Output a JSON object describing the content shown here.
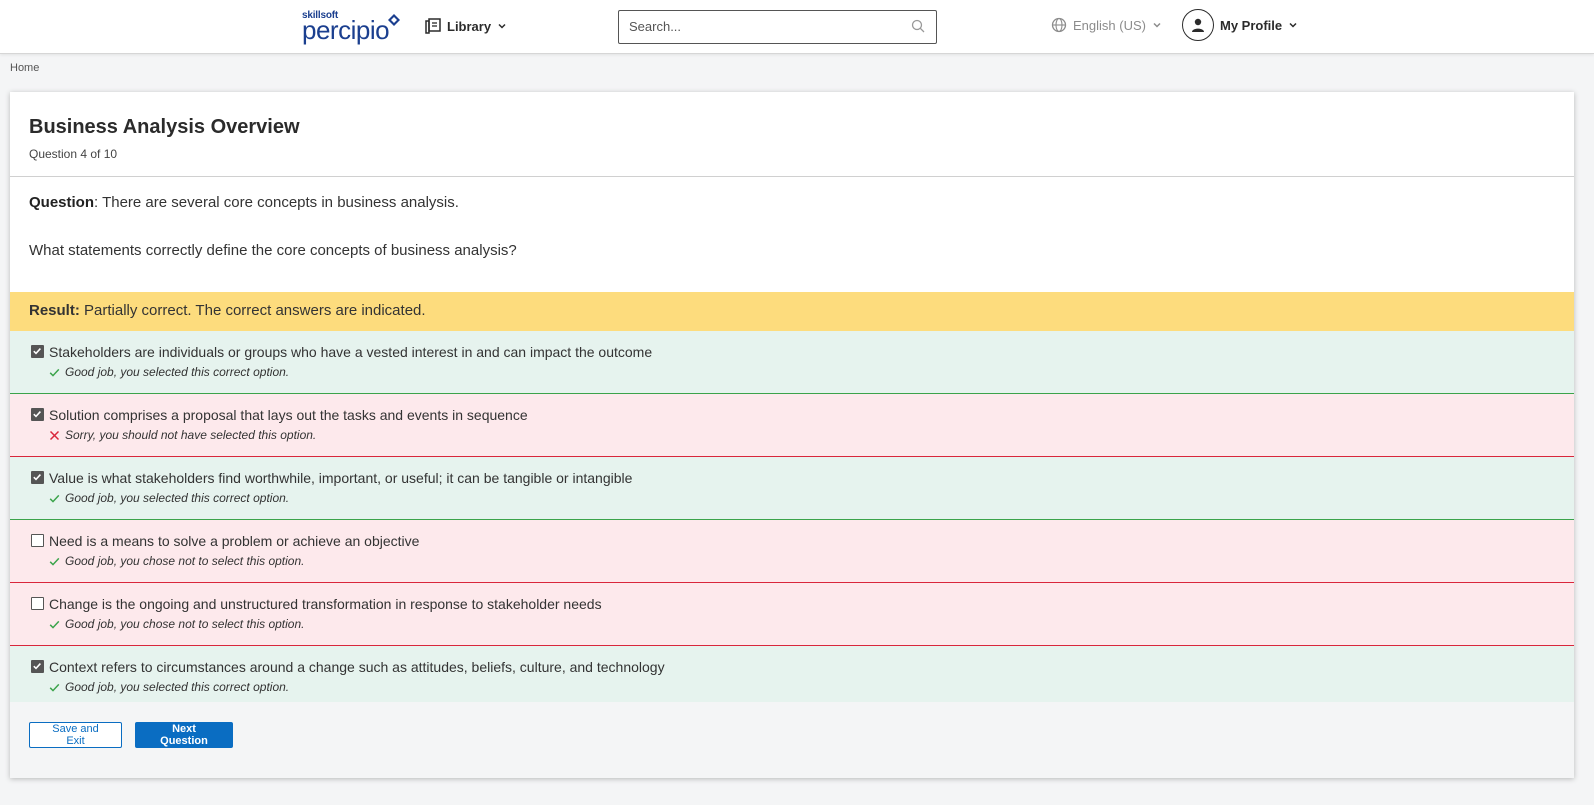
{
  "header": {
    "logo_small": "skillsoft",
    "logo_big": "percipio",
    "library_label": "Library",
    "search_placeholder": "Search...",
    "language_label": "English (US)",
    "profile_label": "My Profile"
  },
  "breadcrumb": {
    "home": "Home"
  },
  "assessment": {
    "title": "Business Analysis Overview",
    "question_count": "Question 4 of 10",
    "question_label": "Question",
    "question_text": ": There are several core concepts in business analysis.",
    "prompt": "What statements correctly define the core concepts of business analysis?",
    "result_label": "Result:",
    "result_text": " Partially correct. The correct answers are indicated."
  },
  "options": [
    {
      "text": "Stakeholders are individuals or groups who have a vested interest in and can impact the outcome",
      "checked": true,
      "status": "good",
      "feedback_icon": "check-icon",
      "feedback": "Good job, you selected this correct option."
    },
    {
      "text": "Solution comprises a proposal that lays out the tasks and events in sequence",
      "checked": true,
      "status": "bad",
      "feedback_icon": "x-icon",
      "feedback": "Sorry, you should not have selected this option."
    },
    {
      "text": "Value is what stakeholders find worthwhile, important, or useful; it can be tangible or intangible",
      "checked": true,
      "status": "good",
      "feedback_icon": "check-icon",
      "feedback": "Good job, you selected this correct option."
    },
    {
      "text": "Need is a means to solve a problem or achieve an objective",
      "checked": false,
      "status": "bad",
      "feedback_icon": "check-icon",
      "feedback": "Good job, you chose not to select this option."
    },
    {
      "text": "Change is the ongoing and unstructured transformation in response to stakeholder needs",
      "checked": false,
      "status": "bad",
      "feedback_icon": "check-icon",
      "feedback": "Good job, you chose not to select this option."
    },
    {
      "text": "Context refers to circumstances around a change such as attitudes, beliefs, culture, and technology",
      "checked": true,
      "status": "good",
      "feedback_icon": "check-icon",
      "feedback": "Good job, you selected this correct option."
    }
  ],
  "footer": {
    "save_exit_label": "Save and Exit",
    "next_label": "Next Question"
  },
  "colors": {
    "brand_blue": "#0a6dc2",
    "result_bg": "#fddc7d",
    "correct_bg": "#e6f3ee",
    "correct_border": "#3aa34a",
    "incorrect_bg": "#fde9ec",
    "incorrect_border": "#d9263b"
  }
}
